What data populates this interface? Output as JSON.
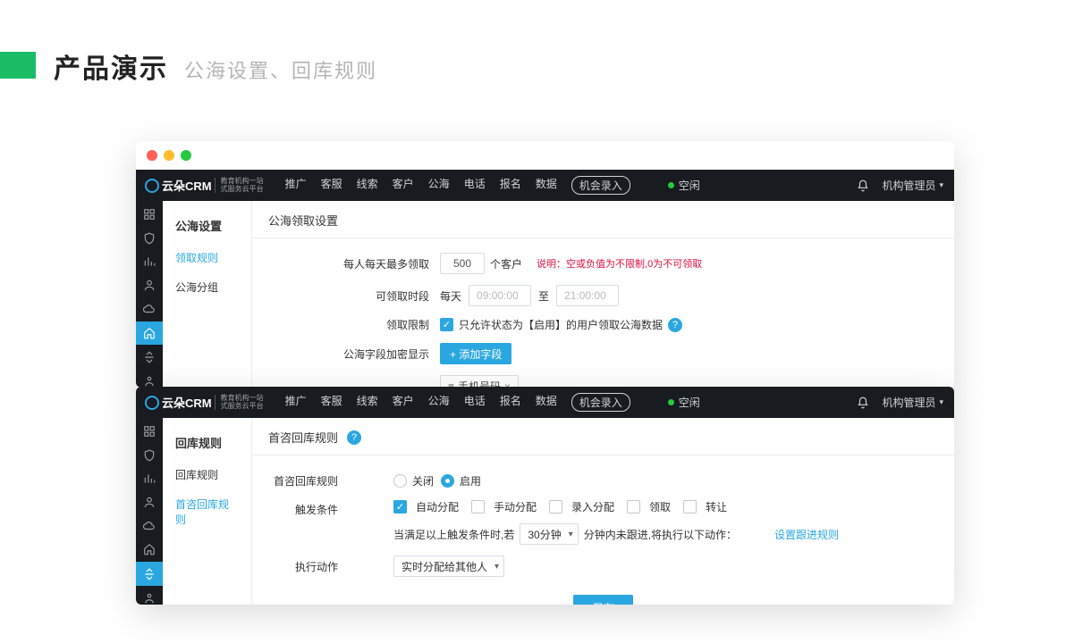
{
  "heading": {
    "title": "产品演示",
    "subtitle": "公海设置、回库规则"
  },
  "common": {
    "logo_brand": "云朵CRM",
    "logo_sub1": "教育机构一站",
    "logo_sub2": "式服务云平台",
    "nav": [
      "推广",
      "客服",
      "线索",
      "客户",
      "公海",
      "电话",
      "报名",
      "数据"
    ],
    "nav_pill": "机会录入",
    "status": "空闲",
    "user": "机构管理员"
  },
  "winA": {
    "side_title": "公海设置",
    "side_items": [
      "领取规则",
      "公海分组"
    ],
    "side_active_index": 0,
    "section_title": "公海领取设置",
    "row1": {
      "label": "每人每天最多领取",
      "value": "500",
      "unit": "个客户",
      "note": "说明：空或负值为不限制,0为不可领取"
    },
    "row2": {
      "label": "可领取时段",
      "daily": "每天",
      "from": "09:00:00",
      "to_label": "至",
      "to": "21:00:00"
    },
    "row3": {
      "label": "领取限制",
      "cb_checked": true,
      "text": "只允许状态为【启用】的用户领取公海数据"
    },
    "row4": {
      "label": "公海字段加密显示",
      "add_btn": "+ 添加字段"
    },
    "chip": {
      "icon": "≡",
      "text": "手机号码",
      "close": "×"
    }
  },
  "winB": {
    "side_title": "回库规则",
    "side_items": [
      "回库规则",
      "首咨回库规则"
    ],
    "side_active_index": 1,
    "section_title": "首咨回库规则",
    "row1": {
      "label": "首咨回库规则",
      "opt_off": "关闭",
      "opt_on": "启用",
      "selected": "on"
    },
    "row2": {
      "label": "触发条件",
      "opts": [
        {
          "text": "自动分配",
          "checked": true
        },
        {
          "text": "手动分配",
          "checked": false
        },
        {
          "text": "录入分配",
          "checked": false
        },
        {
          "text": "领取",
          "checked": false
        },
        {
          "text": "转让",
          "checked": false
        }
      ],
      "desc_prefix": "当满足以上触发条件时,若",
      "duration": "30分钟",
      "desc_suffix": "分钟内未跟进,将执行以下动作：",
      "link": "设置跟进规则"
    },
    "row3": {
      "label": "执行动作",
      "select": "实时分配给其他人"
    },
    "save": "保存"
  }
}
